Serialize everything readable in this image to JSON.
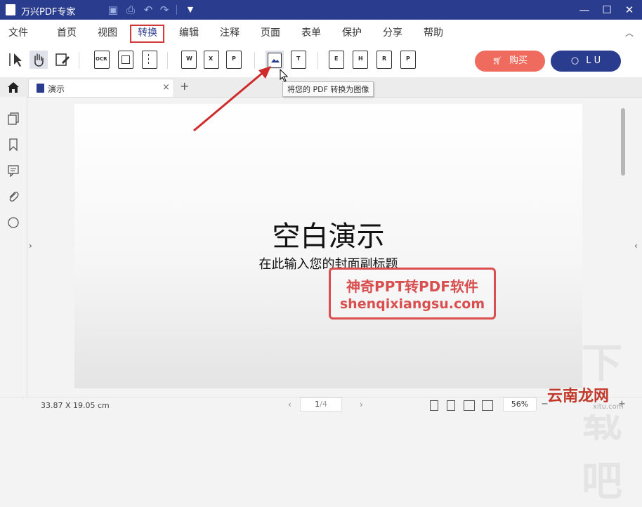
{
  "window": {
    "title": "万兴PDF专家"
  },
  "menu": {
    "items": [
      "文件",
      "首页",
      "视图",
      "转换",
      "编辑",
      "注释",
      "页面",
      "表单",
      "保护",
      "分享",
      "帮助"
    ]
  },
  "toolbar": {
    "ocr_label": "OCR",
    "buy_label": "购买",
    "user_label": "L U",
    "tooltip": "将您的 PDF 转换为图像",
    "word_mark": "W",
    "excel_mark": "X",
    "ppt_mark": "P",
    "text_mark": "T",
    "epub_mark": "E",
    "html_mark": "H",
    "rtf_mark": "R",
    "pdfa_mark": "P"
  },
  "tabs": {
    "doc_title": "演示",
    "close": "×",
    "add": "+"
  },
  "slide": {
    "title": "空白演示",
    "subtitle": "在此输入您的封面副标题"
  },
  "watermark": {
    "line1": "神奇PPT转PDF软件",
    "line2": "shenqixiangsu.com"
  },
  "status": {
    "dimensions": "33.87 X 19.05 cm",
    "page_current": "1",
    "page_total": "/4",
    "zoom": "56%",
    "zoom_minus": "−",
    "zoom_plus": "+"
  },
  "site_logo": {
    "main": "云南龙网",
    "sub": "xitu.com",
    "bg": "下载吧"
  },
  "colors": {
    "titlebar": "#2a3c8e",
    "buy": "#ef6b5e",
    "user": "#2a3c8e",
    "highlight": "#d23a3a",
    "watermark": "#d94f4f"
  }
}
